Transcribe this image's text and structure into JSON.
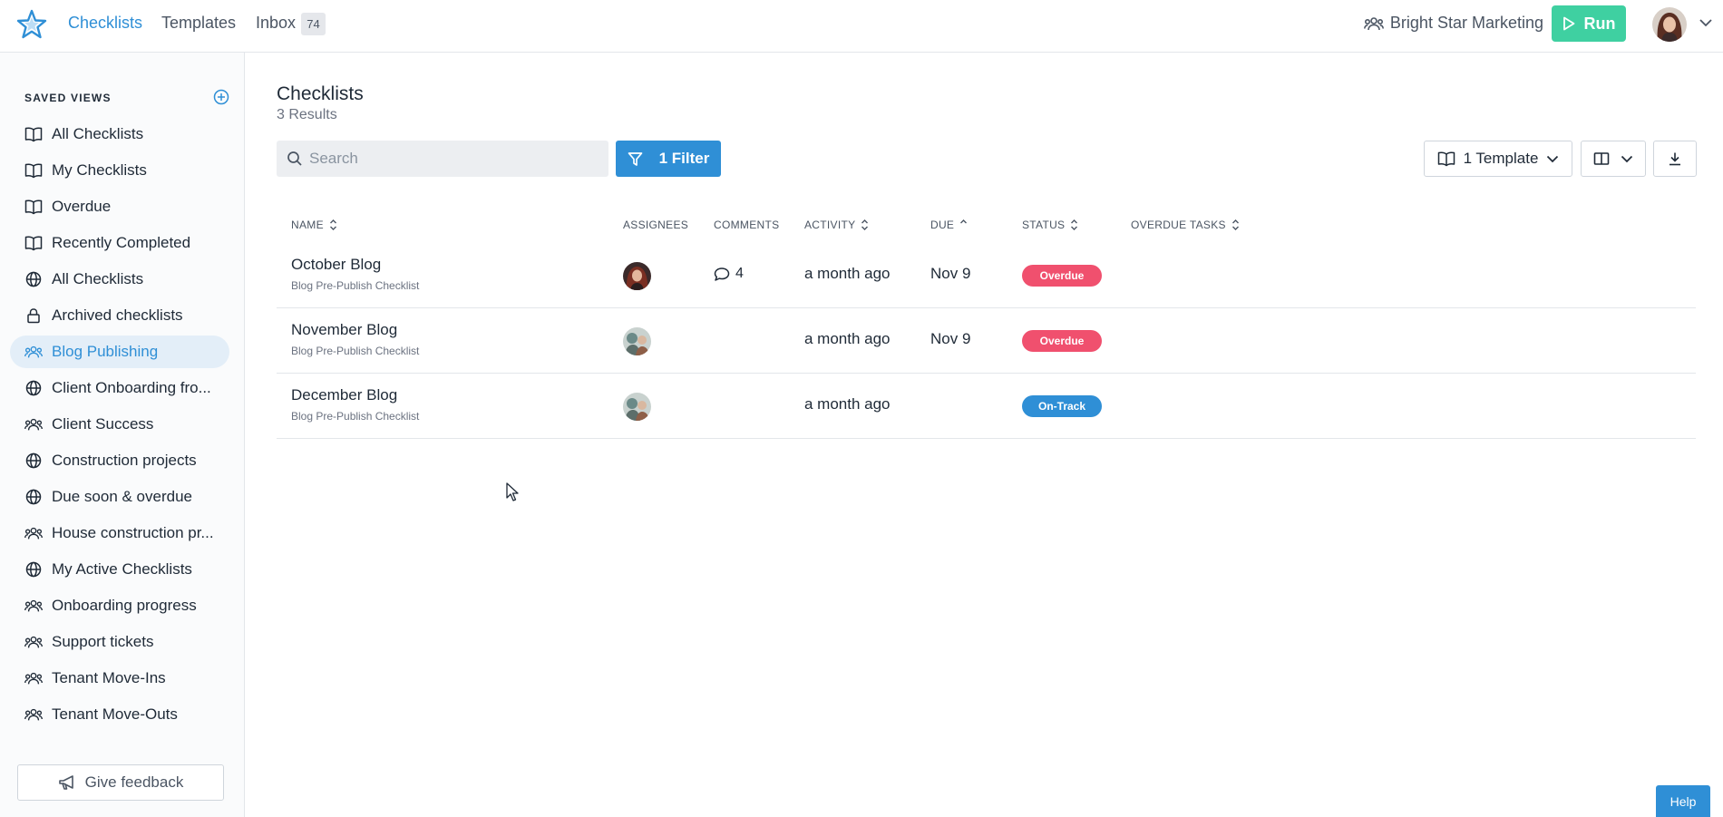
{
  "nav": {
    "links": [
      {
        "label": "Checklists",
        "active": true
      },
      {
        "label": "Templates",
        "active": false
      },
      {
        "label": "Inbox",
        "active": false
      }
    ],
    "inbox_count": "74",
    "org_name": "Bright Star Marketing",
    "run_label": "Run"
  },
  "sidebar": {
    "header": "SAVED VIEWS",
    "items": [
      {
        "label": "All Checklists",
        "icon": "book-icon"
      },
      {
        "label": "My Checklists",
        "icon": "book-icon"
      },
      {
        "label": "Overdue",
        "icon": "book-icon"
      },
      {
        "label": "Recently Completed",
        "icon": "book-icon"
      },
      {
        "label": "All Checklists",
        "icon": "globe-icon"
      },
      {
        "label": "Archived checklists",
        "icon": "lock-icon"
      },
      {
        "label": "Blog Publishing",
        "icon": "users-icon",
        "active": true
      },
      {
        "label": "Client Onboarding fro...",
        "icon": "globe-icon"
      },
      {
        "label": "Client Success",
        "icon": "users-icon"
      },
      {
        "label": "Construction projects",
        "icon": "globe-icon"
      },
      {
        "label": "Due soon & overdue",
        "icon": "globe-icon"
      },
      {
        "label": "House construction pr...",
        "icon": "users-icon"
      },
      {
        "label": "My Active Checklists",
        "icon": "globe-icon"
      },
      {
        "label": "Onboarding progress",
        "icon": "users-icon"
      },
      {
        "label": "Support tickets",
        "icon": "users-icon"
      },
      {
        "label": "Tenant Move-Ins",
        "icon": "users-icon"
      },
      {
        "label": "Tenant Move-Outs",
        "icon": "users-icon"
      }
    ],
    "feedback_label": "Give feedback"
  },
  "main": {
    "title": "Checklists",
    "results": "3 Results",
    "search_placeholder": "Search",
    "filter_label": "1 Filter",
    "template_label": "1 Template",
    "columns": [
      "NAME",
      "ASSIGNEES",
      "COMMENTS",
      "ACTIVITY",
      "DUE",
      "STATUS",
      "OVERDUE TASKS"
    ],
    "rows": [
      {
        "name": "October Blog",
        "template": "Blog Pre-Publish Checklist",
        "comments": "4",
        "activity": "a month ago",
        "due": "Nov 9",
        "status": "Overdue"
      },
      {
        "name": "November Blog",
        "template": "Blog Pre-Publish Checklist",
        "comments": "",
        "activity": "a month ago",
        "due": "Nov 9",
        "status": "Overdue"
      },
      {
        "name": "December Blog",
        "template": "Blog Pre-Publish Checklist",
        "comments": "",
        "activity": "a month ago",
        "due": "",
        "status": "On-Track"
      }
    ]
  },
  "colors": {
    "accent": "#2f8fd6",
    "run_green": "#3fd0a1",
    "overdue": "#f0506e",
    "on_track": "#2f8fd6"
  },
  "help_label": "Help"
}
